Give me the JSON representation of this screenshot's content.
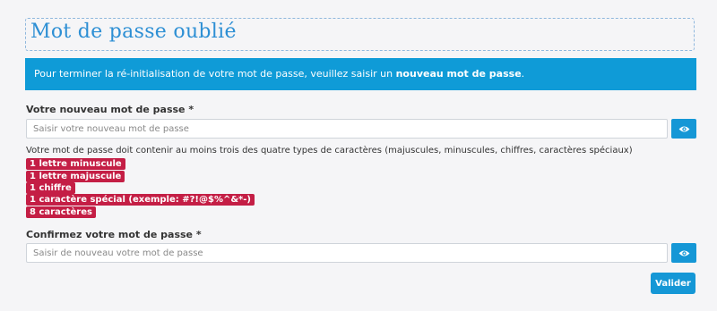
{
  "page": {
    "title": "Mot de passe oublié"
  },
  "info": {
    "text_before": "Pour terminer la ré-initialisation de votre mot de passe, veuillez saisir un ",
    "text_bold": "nouveau mot de passe",
    "text_after": "."
  },
  "new_password": {
    "label": "Votre nouveau mot de passe *",
    "placeholder": "Saisir votre nouveau mot de passe",
    "value": ""
  },
  "rules": {
    "intro": "Votre mot de passe doit contenir au moins trois des quatre types de caractères (majuscules, minuscules, chiffres, caractères spéciaux)",
    "items": [
      "1 lettre minuscule",
      "1 lettre majuscule",
      "1 chiffre",
      "1 caractère spécial (exemple: #?!@$%^&*-)",
      "8 caractères"
    ]
  },
  "confirm_password": {
    "label": "Confirmez votre mot de passe *",
    "placeholder": "Saisir de nouveau votre mot de passe",
    "value": ""
  },
  "submit_label": "Valider",
  "colors": {
    "accent": "#1597d6",
    "info_background": "#0f9bd7",
    "rule_badge": "#c41e45",
    "title": "#2d8fd4"
  },
  "icons": {
    "toggle_visibility": "eye-icon"
  }
}
